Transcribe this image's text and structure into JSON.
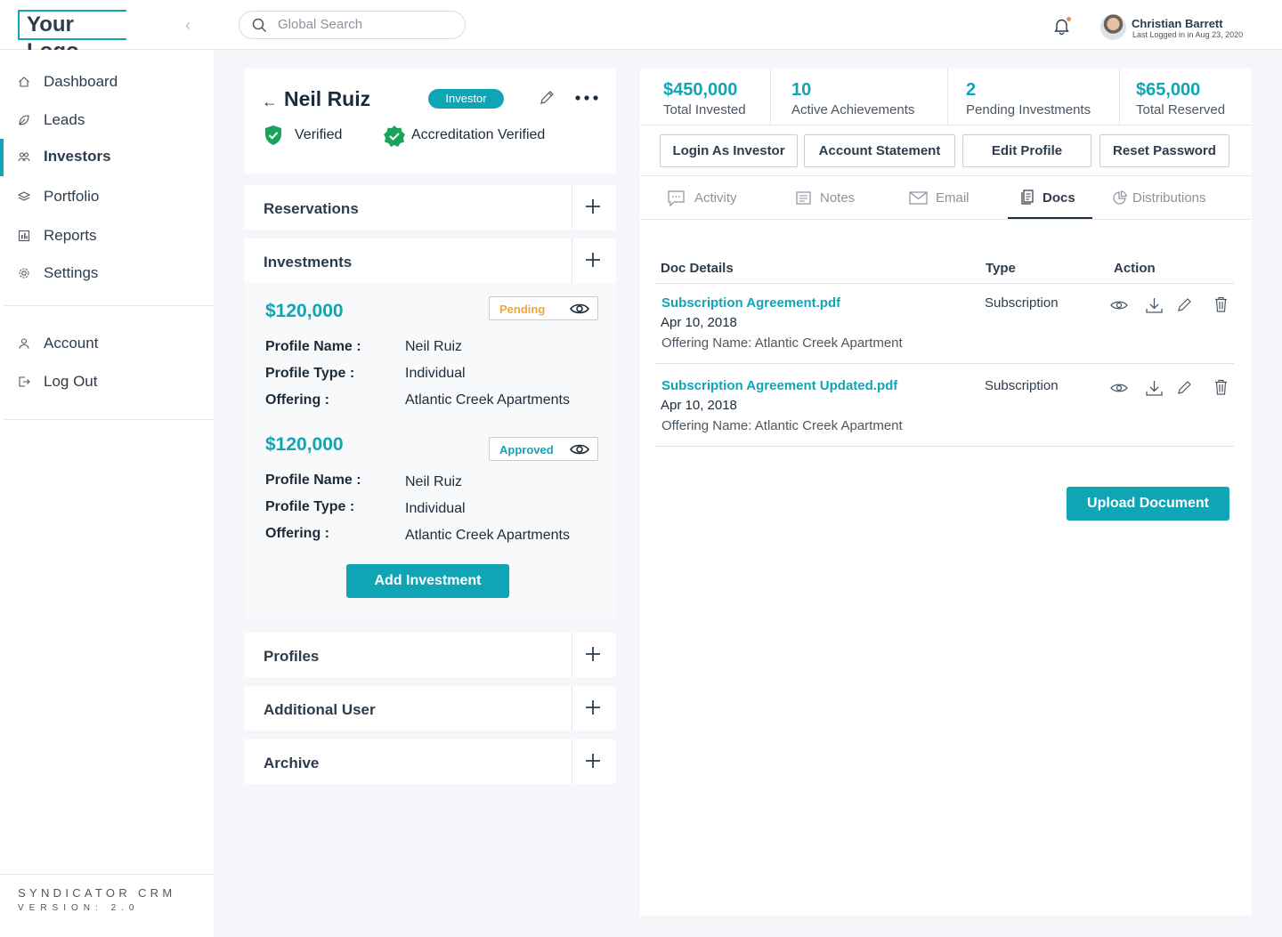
{
  "header": {
    "logo": "Your Logo",
    "search_placeholder": "Global Search",
    "user_name": "Christian Barrett",
    "user_last_login": "Last Logged in in Aug 23, 2020"
  },
  "sidebar": {
    "items": [
      {
        "label": "Dashboard",
        "icon": "home-icon"
      },
      {
        "label": "Leads",
        "icon": "leaf-icon"
      },
      {
        "label": "Investors",
        "icon": "users-icon",
        "active": true
      },
      {
        "label": "Portfolio",
        "icon": "layers-icon"
      },
      {
        "label": "Reports",
        "icon": "chart-icon"
      },
      {
        "label": "Settings",
        "icon": "gear-icon"
      }
    ],
    "secondary": [
      {
        "label": "Account",
        "icon": "user-icon"
      },
      {
        "label": "Log Out",
        "icon": "logout-icon"
      }
    ],
    "brand": "SYNDICATOR CRM",
    "version": "VERSION: 2.0"
  },
  "profile": {
    "name": "Neil Ruiz",
    "badge": "Investor",
    "verified": "Verified",
    "accreditation": "Accreditation Verified"
  },
  "sections": {
    "reservations": "Reservations",
    "investments": "Investments",
    "profiles": "Profiles",
    "additional_user": "Additional User",
    "archive": "Archive"
  },
  "investments": [
    {
      "amount": "$120,000",
      "status": "Pending",
      "status_color": "#f0a53c",
      "profile_name": "Neil Ruiz",
      "profile_type": "Individual",
      "offering": "Atlantic Creek Apartments"
    },
    {
      "amount": "$120,000",
      "status": "Approved",
      "status_color": "#10a5b5",
      "profile_name": "Neil Ruiz",
      "profile_type": "Individual",
      "offering": "Atlantic Creek Apartments"
    }
  ],
  "investment_labels": {
    "profile_name": "Profile Name :",
    "profile_type": "Profile Type :",
    "offering": "Offering :"
  },
  "add_investment_label": "Add Investment",
  "stats": [
    {
      "value": "$450,000",
      "label": "Total Invested"
    },
    {
      "value": "10",
      "label": "Active Achievements"
    },
    {
      "value": "2",
      "label": "Pending Investments"
    },
    {
      "value": "$65,000",
      "label": "Total Reserved"
    }
  ],
  "actions": {
    "login_as": "Login As Investor",
    "statement": "Account Statement",
    "edit": "Edit Profile",
    "reset": "Reset Password"
  },
  "tabs": [
    {
      "label": "Activity",
      "icon": "chat-icon"
    },
    {
      "label": "Notes",
      "icon": "notes-icon"
    },
    {
      "label": "Email",
      "icon": "mail-icon"
    },
    {
      "label": "Docs",
      "icon": "doc-icon",
      "active": true
    },
    {
      "label": "Distributions",
      "icon": "pie-icon"
    }
  ],
  "docs_table": {
    "headers": [
      "Doc Details",
      "Type",
      "Action"
    ],
    "rows": [
      {
        "name": "Subscription Agreement.pdf",
        "date": "Apr 10, 2018",
        "offering": "Offering Name: Atlantic Creek Apartment",
        "type": "Subscription"
      },
      {
        "name": "Subscription Agreement Updated.pdf",
        "date": "Apr 10, 2018",
        "offering": "Offering Name: Atlantic Creek Apartment",
        "type": "Subscription"
      }
    ]
  },
  "upload_label": "Upload Document",
  "colors": {
    "accent": "#10a5b5",
    "pending": "#f0a53c",
    "verified_green": "#1aa35a"
  }
}
